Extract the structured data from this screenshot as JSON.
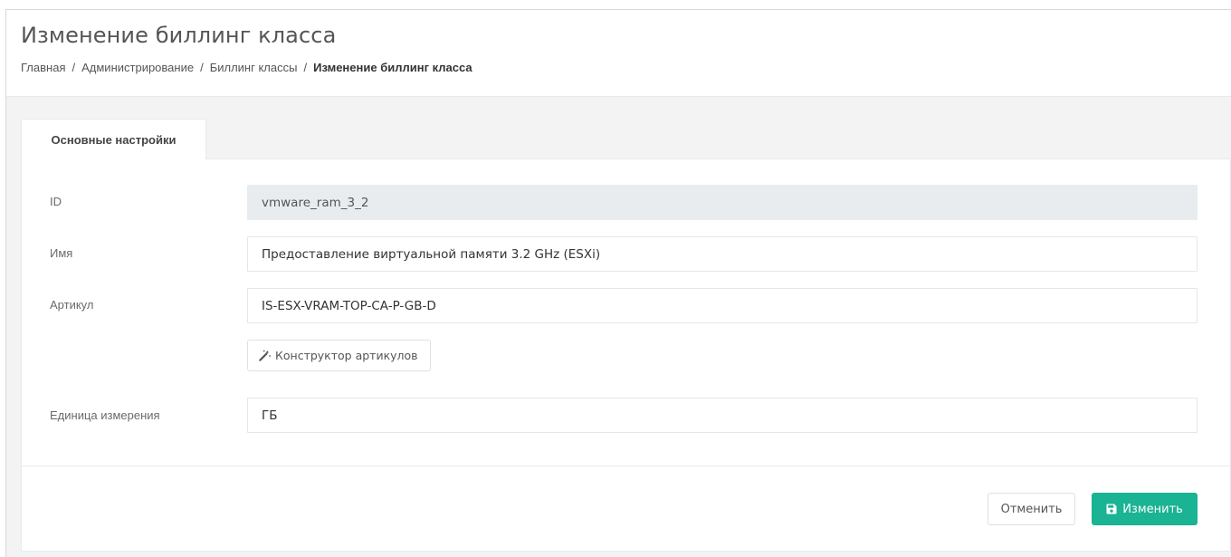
{
  "page": {
    "title": "Изменение биллинг класса"
  },
  "breadcrumb": {
    "items": [
      "Главная",
      "Администрирование",
      "Биллинг классы"
    ],
    "active": "Изменение биллинг класса",
    "separator": "/"
  },
  "tabs": [
    {
      "label": "Основные настройки",
      "active": true
    }
  ],
  "form": {
    "id": {
      "label": "ID",
      "value": "vmware_ram_3_2",
      "readonly": true
    },
    "name": {
      "label": "Имя",
      "value": "Предоставление виртуальной памяти 3.2 GHz (ESXi)"
    },
    "article": {
      "label": "Артикул",
      "value": "IS-ESX-VRAM-TOP-CA-P-GB-D"
    },
    "article_builder_label": "Конструктор артикулов",
    "unit": {
      "label": "Единица измерения",
      "value": "ГБ"
    }
  },
  "actions": {
    "cancel_label": "Отменить",
    "save_label": "Изменить"
  },
  "icons": {
    "article_builder": "magic-wand-icon",
    "save": "floppy-disk-icon"
  },
  "colors": {
    "accent": "#1ab394",
    "readonly_bg": "#e9ecef"
  }
}
